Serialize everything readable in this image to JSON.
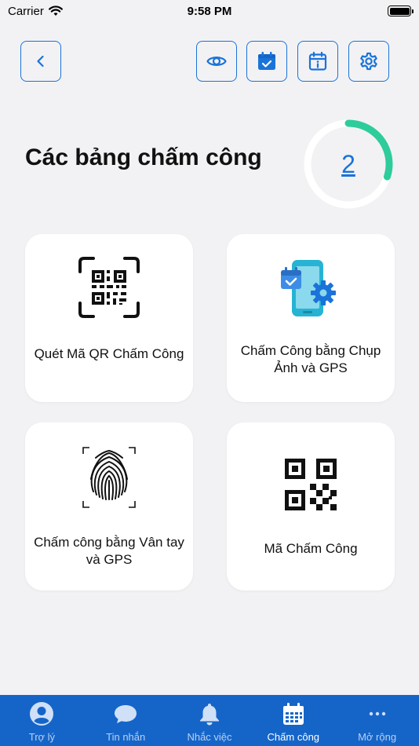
{
  "status_bar": {
    "carrier": "Carrier",
    "time": "9:58 PM"
  },
  "toolbar": {
    "back_icon": "chevron-left-icon",
    "actions": [
      "eye-icon",
      "calendar-check-icon",
      "calendar-info-icon",
      "gear-icon"
    ]
  },
  "header": {
    "title": "Các bảng chấm công",
    "count": "2",
    "progress": 0.3
  },
  "cards": [
    {
      "label": "Quét Mã QR Chấm Công",
      "icon": "qr-scan-icon"
    },
    {
      "label": "Chấm Công bằng Chụp Ảnh   và GPS",
      "icon": "phone-settings-icon"
    },
    {
      "label": "Chấm công bằng Vân tay  và GPS",
      "icon": "fingerprint-icon"
    },
    {
      "label": "Mã Chấm Công",
      "icon": "qr-code-icon"
    }
  ],
  "tabs": [
    {
      "label": "Trợ lý",
      "icon": "user-icon"
    },
    {
      "label": "Tin nhắn",
      "icon": "chat-icon"
    },
    {
      "label": "Nhắc việc",
      "icon": "bell-icon"
    },
    {
      "label": "Chấm công",
      "icon": "calendar-icon",
      "active": true
    },
    {
      "label": "Mở rộng",
      "icon": "more-icon"
    }
  ],
  "colors": {
    "accent": "#1a73d9",
    "tab_bar": "#1565c9",
    "ring": "#2ecc9a"
  }
}
